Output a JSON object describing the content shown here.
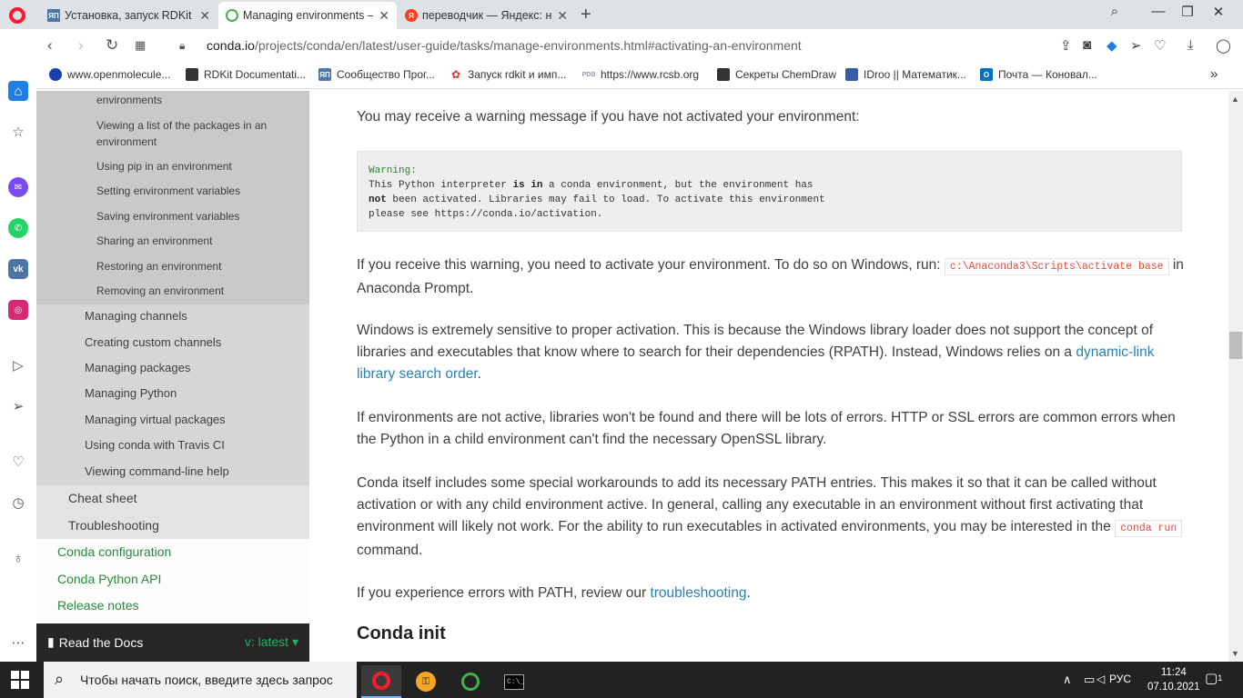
{
  "browser": {
    "tabs": [
      {
        "label": "Установка, запуск RDKit и",
        "icon": "habr-icon",
        "active": false
      },
      {
        "label": "Managing environments —",
        "icon": "conda-icon",
        "active": true
      },
      {
        "label": "переводчик — Яндекс: на",
        "icon": "yandex-icon",
        "active": false
      }
    ],
    "url_host": "conda.io",
    "url_path": "/projects/conda/en/latest/user-guide/tasks/manage-environments.html#activating-an-environment",
    "bookmarks": [
      "www.openmolecule...",
      "RDKit Documentati...",
      "Сообщество Прог...",
      "Запуск rdkit и имп...",
      "https://www.rcsb.org",
      "Секреты ChemDraw",
      "IDroo || Математик...",
      "Почта — Коновал..."
    ]
  },
  "sidebar_nav": {
    "level4": [
      "environments",
      "Viewing a list of the packages in an environment",
      "Using pip in an environment",
      "Setting environment variables",
      "Saving environment variables",
      "Sharing an environment",
      "Restoring an environment",
      "Removing an environment"
    ],
    "level3": [
      "Managing channels",
      "Creating custom channels",
      "Managing packages",
      "Managing Python",
      "Managing virtual packages",
      "Using conda with Travis CI",
      "Viewing command-line help"
    ],
    "level2": [
      "Cheat sheet",
      "Troubleshooting"
    ],
    "level1": [
      "Conda configuration",
      "Conda Python API",
      "Release notes"
    ],
    "rtd_label": "Read the Docs",
    "rtd_version": "v: latest"
  },
  "content": {
    "intro": "You may receive a warning message if you have not activated your environment:",
    "pre": {
      "line1": "Warning:",
      "line2_a": "This Python interpreter ",
      "line2_b": "is in",
      "line2_c": " a conda environment, but the environment has",
      "line3_a": "not",
      "line3_b": " been activated. Libraries may fail to load. To activate this environment",
      "line4": "please see https://conda.io/activation."
    },
    "p1_a": "If you receive this warning, you need to activate your environment. To do so on Windows, run: ",
    "p1_code": "c:\\Anaconda3\\Scripts\\activate base",
    "p1_b": " in Anaconda Prompt.",
    "p2_a": "Windows is extremely sensitive to proper activation. This is because the Windows library loader does not support the concept of libraries and executables that know where to search for their dependencies (RPATH). Instead, Windows relies on a ",
    "p2_link": "dynamic-link library search order",
    "p2_b": ".",
    "p3": "If environments are not active, libraries won't be found and there will be lots of errors. HTTP or SSL errors are common errors when the Python in a child environment can't find the necessary OpenSSL library.",
    "p4_a": "Conda itself includes some special workarounds to add its necessary PATH entries. This makes it so that it can be called without activation or with any child environment active. In general, calling any executable in an environment without first activating that environment will likely not work. For the ability to run executables in activated environments, you may be interested in the ",
    "p4_code": "conda run",
    "p4_b": " command.",
    "p5_a": "If you experience errors with PATH, review our ",
    "p5_link": "troubleshooting",
    "p5_b": ".",
    "heading": "Conda init"
  },
  "taskbar": {
    "search_placeholder": "Чтобы начать поиск, введите здесь запрос",
    "lang": "РУС",
    "time": "11:24",
    "date": "07.10.2021",
    "notifications": "1"
  }
}
